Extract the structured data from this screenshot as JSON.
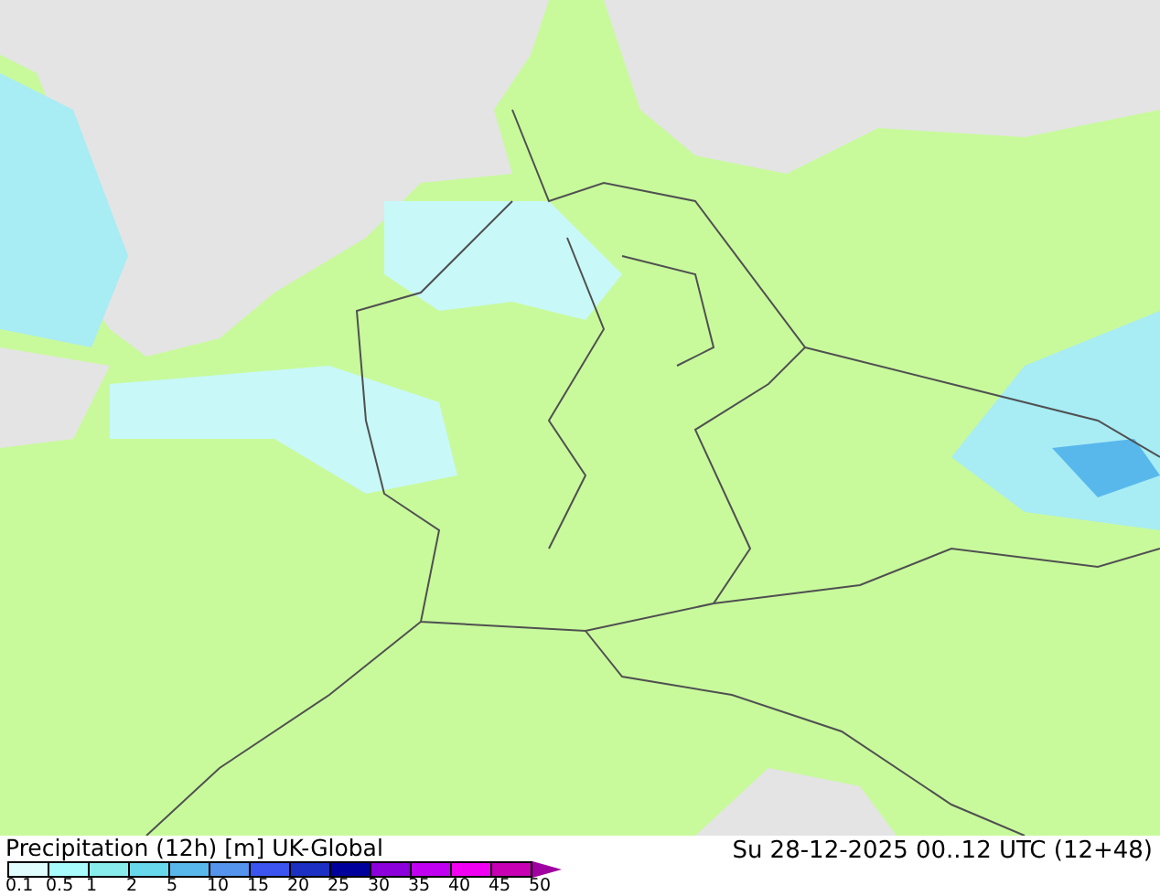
{
  "title": "Precipitation (12h) [m] UK-Global",
  "valid_time": "Su 28-12-2025 00..12 UTC (12+48)",
  "legend": {
    "swatches": [
      {
        "color": "#e0fcfc"
      },
      {
        "color": "#a8fcfc"
      },
      {
        "color": "#88ecec"
      },
      {
        "color": "#68d8ec"
      },
      {
        "color": "#58b8ec"
      },
      {
        "color": "#5494ec"
      },
      {
        "color": "#3c54f0"
      },
      {
        "color": "#1c30c4"
      },
      {
        "color": "#00009c"
      },
      {
        "color": "#8c00dc"
      },
      {
        "color": "#c000f0"
      },
      {
        "color": "#f000f0"
      },
      {
        "color": "#c800b4"
      }
    ],
    "labels": [
      "0.1",
      "0.5",
      "1",
      "2",
      "5",
      "10",
      "15",
      "20",
      "25",
      "30",
      "35",
      "40",
      "45",
      "50"
    ]
  }
}
